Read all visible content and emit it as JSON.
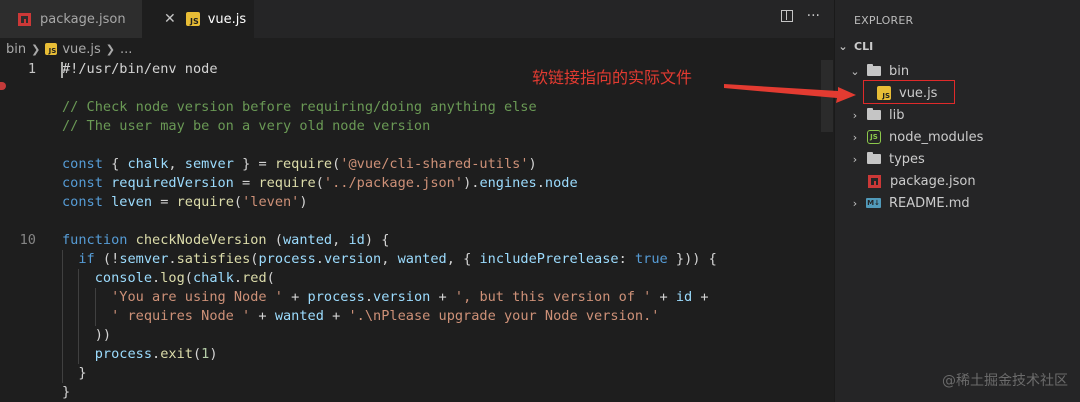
{
  "tabs": [
    {
      "label": "package.json",
      "icon": "npm-package-icon",
      "active": false
    },
    {
      "label": "vue.js",
      "icon": "js-file-icon",
      "active": true
    }
  ],
  "tab_actions": {
    "split": "split-editor-icon",
    "more": "···"
  },
  "breadcrumb": {
    "folder": "bin",
    "file": "vue.js",
    "tail": "..."
  },
  "code": {
    "line_numbers": {
      "first": "1",
      "tenth": "10"
    },
    "lines": [
      [
        [
          "pn",
          "#!/usr/bin/env node"
        ]
      ],
      [],
      [
        [
          "cm",
          "// Check node version before requiring/doing anything else"
        ]
      ],
      [
        [
          "cm",
          "// The user may be on a very old node version"
        ]
      ],
      [],
      [
        [
          "kw",
          "const"
        ],
        [
          "pn",
          " { "
        ],
        [
          "var",
          "chalk"
        ],
        [
          "pn",
          ", "
        ],
        [
          "var",
          "semver"
        ],
        [
          "pn",
          " } = "
        ],
        [
          "fn",
          "require"
        ],
        [
          "pn",
          "("
        ],
        [
          "str",
          "'@vue/cli-shared-utils'"
        ],
        [
          "pn",
          ")"
        ]
      ],
      [
        [
          "kw",
          "const"
        ],
        [
          "pn",
          " "
        ],
        [
          "var",
          "requiredVersion"
        ],
        [
          "pn",
          " = "
        ],
        [
          "fn",
          "require"
        ],
        [
          "pn",
          "("
        ],
        [
          "str",
          "'../package.json'"
        ],
        [
          "pn",
          ")."
        ],
        [
          "var",
          "engines"
        ],
        [
          "pn",
          "."
        ],
        [
          "var",
          "node"
        ]
      ],
      [
        [
          "kw",
          "const"
        ],
        [
          "pn",
          " "
        ],
        [
          "var",
          "leven"
        ],
        [
          "pn",
          " = "
        ],
        [
          "fn",
          "require"
        ],
        [
          "pn",
          "("
        ],
        [
          "str",
          "'leven'"
        ],
        [
          "pn",
          ")"
        ]
      ],
      [],
      [
        [
          "kw",
          "function"
        ],
        [
          "pn",
          " "
        ],
        [
          "fn",
          "checkNodeVersion"
        ],
        [
          "pn",
          " ("
        ],
        [
          "var",
          "wanted"
        ],
        [
          "pn",
          ", "
        ],
        [
          "var",
          "id"
        ],
        [
          "pn",
          ") {"
        ]
      ],
      [
        [
          "pn",
          "  "
        ],
        [
          "kw",
          "if"
        ],
        [
          "pn",
          " (!"
        ],
        [
          "var",
          "semver"
        ],
        [
          "pn",
          "."
        ],
        [
          "fn",
          "satisfies"
        ],
        [
          "pn",
          "("
        ],
        [
          "var",
          "process"
        ],
        [
          "pn",
          "."
        ],
        [
          "var",
          "version"
        ],
        [
          "pn",
          ", "
        ],
        [
          "var",
          "wanted"
        ],
        [
          "pn",
          ", { "
        ],
        [
          "var",
          "includePrerelease"
        ],
        [
          "pn",
          ": "
        ],
        [
          "kw",
          "true"
        ],
        [
          "pn",
          " })) {"
        ]
      ],
      [
        [
          "pn",
          "    "
        ],
        [
          "var",
          "console"
        ],
        [
          "pn",
          "."
        ],
        [
          "fn",
          "log"
        ],
        [
          "pn",
          "("
        ],
        [
          "var",
          "chalk"
        ],
        [
          "pn",
          "."
        ],
        [
          "fn",
          "red"
        ],
        [
          "pn",
          "("
        ]
      ],
      [
        [
          "pn",
          "      "
        ],
        [
          "str",
          "'You are using Node '"
        ],
        [
          "pn",
          " + "
        ],
        [
          "var",
          "process"
        ],
        [
          "pn",
          "."
        ],
        [
          "var",
          "version"
        ],
        [
          "pn",
          " + "
        ],
        [
          "str",
          "', but this version of '"
        ],
        [
          "pn",
          " + "
        ],
        [
          "var",
          "id"
        ],
        [
          "pn",
          " +"
        ]
      ],
      [
        [
          "pn",
          "      "
        ],
        [
          "str",
          "' requires Node '"
        ],
        [
          "pn",
          " + "
        ],
        [
          "var",
          "wanted"
        ],
        [
          "pn",
          " + "
        ],
        [
          "str",
          "'.\\nPlease upgrade your Node version.'"
        ]
      ],
      [
        [
          "pn",
          "    ))"
        ]
      ],
      [
        [
          "pn",
          "    "
        ],
        [
          "var",
          "process"
        ],
        [
          "pn",
          "."
        ],
        [
          "fn",
          "exit"
        ],
        [
          "pn",
          "("
        ],
        [
          "num",
          "1"
        ],
        [
          "pn",
          ")"
        ]
      ],
      [
        [
          "pn",
          "  }"
        ]
      ],
      [
        [
          "pn",
          "}"
        ]
      ]
    ]
  },
  "explorer": {
    "title": "EXPLORER",
    "root": "CLI",
    "items": [
      {
        "label": "bin",
        "type": "folder",
        "expanded": true
      },
      {
        "label": "vue.js",
        "type": "js-file",
        "selected": true
      },
      {
        "label": "lib",
        "type": "folder",
        "expanded": false
      },
      {
        "label": "node_modules",
        "type": "node-folder",
        "expanded": false
      },
      {
        "label": "types",
        "type": "folder",
        "expanded": false
      },
      {
        "label": "package.json",
        "type": "npm-file"
      },
      {
        "label": "README.md",
        "type": "markdown-file"
      }
    ]
  },
  "annotation": {
    "text": "软链接指向的实际文件",
    "color": "#e33b31"
  },
  "watermark": "@稀土掘金技术社区",
  "colors": {
    "keyword": "#569cd6",
    "function": "#dcdcaa",
    "string": "#ce9178",
    "comment": "#6a9955",
    "variable": "#9cdcfe",
    "number": "#b5cea8"
  }
}
